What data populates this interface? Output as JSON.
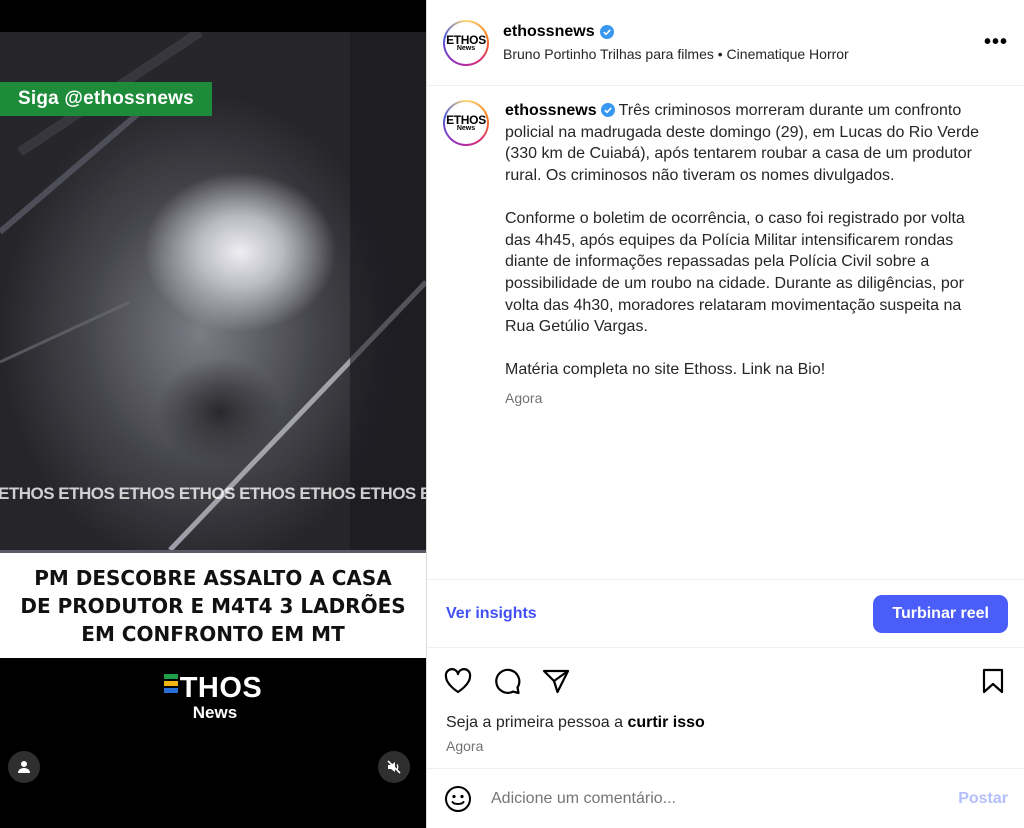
{
  "video": {
    "follow_tag": "Siga @ethossnews",
    "watermark": "ETHOS ETHOS ETHOS ETHOS ETHOS ETHOS ETHOS ETHOS",
    "headline": "PM DESCOBRE ASSALTO A CASA\nDE PRODUTOR E M4T4 3 LADRÕES\nEM CONFRONTO EM MT",
    "brand_name": "THOS",
    "brand_sub": "News"
  },
  "header": {
    "avatar_text": "ETHOS",
    "avatar_sub": "News",
    "username": "ethossnews",
    "audio": "Bruno Portinho Trilhas para filmes • Cinematique Horror",
    "more": "•••"
  },
  "caption": {
    "username": "ethossnews",
    "paragraphs": [
      "Três criminosos morreram durante um confronto policial na madrugada deste domingo (29), em Lucas do Rio Verde (330 km de Cuiabá), após tentarem roubar a casa de um produtor rural. Os criminosos não tiveram os nomes divulgados.",
      "Conforme o boletim de ocorrência, o caso foi registrado por volta das 4h45, após equipes da Polícia Militar intensificarem rondas diante de informações repassadas pela Polícia Civil sobre a possibilidade de um roubo na cidade. Durante as diligências, por volta das 4h30, moradores relataram movimentação suspeita na Rua Getúlio Vargas.",
      "Matéria completa no site Ethoss. Link na Bio!"
    ],
    "time": "Agora"
  },
  "insights": {
    "link": "Ver insights",
    "boost": "Turbinar reel"
  },
  "likes": {
    "prefix": "Seja a primeira pessoa a ",
    "action": "curtir isso",
    "time": "Agora"
  },
  "comment": {
    "placeholder": "Adicione um comentário...",
    "post": "Postar"
  },
  "colors": {
    "accent": "#4a5df9",
    "link": "#4150f7",
    "verified": "#3897f0",
    "follow_tag": "#1d8b3a"
  }
}
